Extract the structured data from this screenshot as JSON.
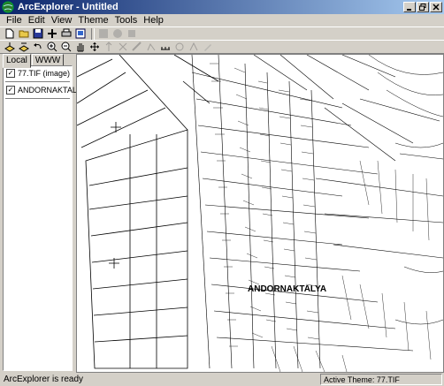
{
  "window": {
    "title": "ArcExplorer - Untitled",
    "buttons": [
      "minimize-icon",
      "restore-icon",
      "close-icon"
    ]
  },
  "menubar": {
    "items": [
      "File",
      "Edit",
      "View",
      "Theme",
      "Tools",
      "Help"
    ]
  },
  "toolbar1": {
    "icons": [
      "new-icon",
      "open-icon",
      "save-icon",
      "add-theme-icon",
      "print-icon",
      "layout-icon",
      "query-icon",
      "stop-icon",
      "refresh-icon"
    ]
  },
  "toolbar2": {
    "icons": [
      "add-layer-icon",
      "remove-layer-icon",
      "undo-icon",
      "zoom-in-icon",
      "zoom-out-icon",
      "pan-icon",
      "full-extent-icon",
      "identify-icon",
      "find-icon",
      "measure-icon",
      "select-icon",
      "scale-icon",
      "buffer-icon",
      "label-icon",
      "edit-icon"
    ]
  },
  "left_panel": {
    "tabs": [
      "Local",
      "WWW"
    ],
    "active_tab": "Local",
    "themes": [
      {
        "label": "77.TIF (image)",
        "checked": true
      },
      {
        "label": "ANDORNAKTALY",
        "checked": true
      }
    ]
  },
  "map": {
    "label": "ANDORNAKTALYA"
  },
  "statusbar": {
    "message": "ArcExplorer is ready",
    "active_theme": "Active Theme: 77.TIF"
  }
}
